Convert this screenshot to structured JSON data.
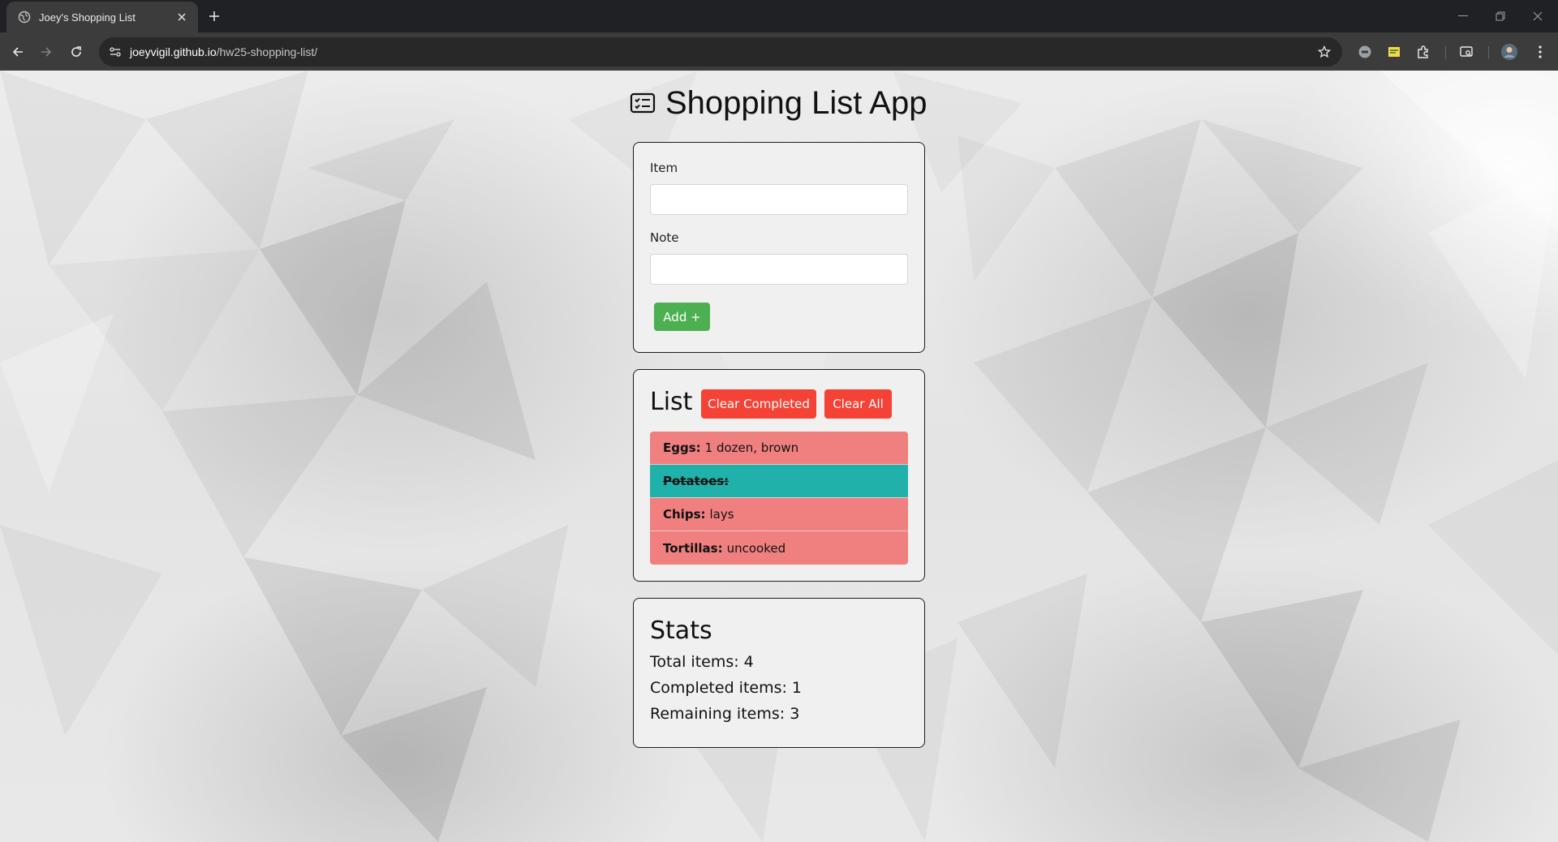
{
  "browser": {
    "tab_title": "Joey's Shopping List",
    "url_host": "joeyvigil.github.io",
    "url_path": "/hw25-shopping-list/"
  },
  "app": {
    "title": "Shopping List App"
  },
  "form": {
    "item_label": "Item",
    "item_value": "",
    "note_label": "Note",
    "note_value": "",
    "add_label": "Add +"
  },
  "list": {
    "heading": "List",
    "clear_completed_label": "Clear Completed",
    "clear_all_label": "Clear All",
    "items": [
      {
        "name": "Eggs:",
        "note": "1 dozen, brown",
        "completed": false
      },
      {
        "name": "Potatoes:",
        "note": "",
        "completed": true
      },
      {
        "name": "Chips:",
        "note": "lays",
        "completed": false
      },
      {
        "name": "Tortillas:",
        "note": "uncooked",
        "completed": false
      }
    ]
  },
  "stats": {
    "heading": "Stats",
    "total": "Total items: 4",
    "completed": "Completed items: 1",
    "remaining": "Remaining items: 3"
  },
  "colors": {
    "add_button": "#4caf50",
    "red_button": "#f44336",
    "item_pending": "#f08080",
    "item_completed": "#20b2aa"
  }
}
